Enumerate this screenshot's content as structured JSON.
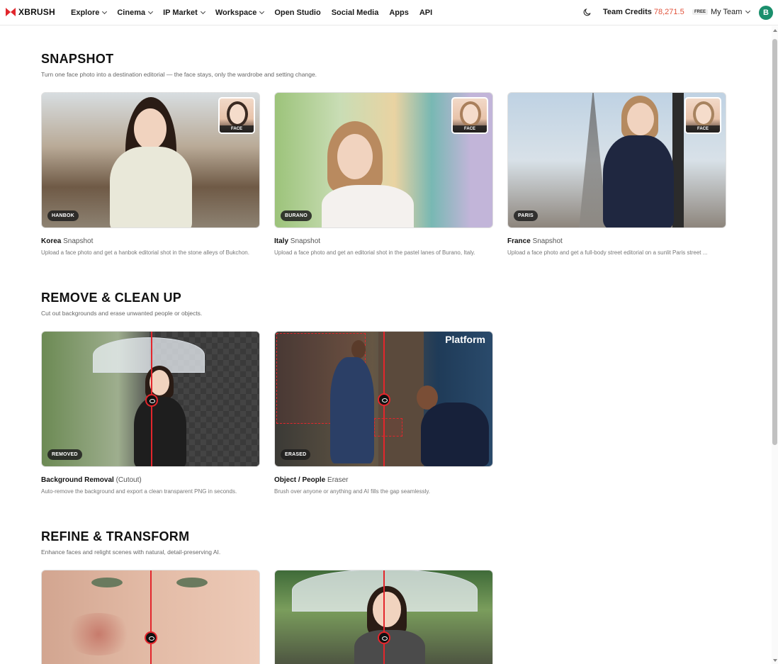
{
  "header": {
    "logo_text": "XBRUSH",
    "nav": [
      {
        "label": "Explore",
        "dropdown": true
      },
      {
        "label": "Cinema",
        "dropdown": true
      },
      {
        "label": "IP Market",
        "dropdown": true
      },
      {
        "label": "Workspace",
        "dropdown": true
      },
      {
        "label": "Open Studio",
        "dropdown": false
      },
      {
        "label": "Social Media",
        "dropdown": false
      },
      {
        "label": "Apps",
        "dropdown": false
      },
      {
        "label": "API",
        "dropdown": false
      }
    ],
    "credits_label": "Team Credits",
    "credits_value": "78,271.5",
    "plan_badge": "FREE",
    "team_label": "My Team",
    "avatar_initial": "B"
  },
  "sections": [
    {
      "title": "SNAPSHOT",
      "subtitle": "Turn one face photo into a destination editorial — the face stays, only the wardrobe and setting change.",
      "cards": [
        {
          "tag": "HANBOK",
          "face_label": "FACE",
          "title_bold": "Korea",
          "title_light": "Snapshot",
          "desc": "Upload a face photo and get a hanbok editorial shot in the stone alleys of Bukchon."
        },
        {
          "tag": "BURANO",
          "face_label": "FACE",
          "title_bold": "Italy",
          "title_light": "Snapshot",
          "desc": "Upload a face photo and get an editorial shot in the pastel lanes of Burano, Italy."
        },
        {
          "tag": "PARIS",
          "face_label": "FACE",
          "title_bold": "France",
          "title_light": "Snapshot",
          "desc": "Upload a face photo and get a full-body street editorial on a sunlit Paris street ..."
        }
      ]
    },
    {
      "title": "REMOVE & CLEAN UP",
      "subtitle": "Cut out backgrounds and erase unwanted people or objects.",
      "cards": [
        {
          "tag": "REMOVED",
          "title_bold": "Background Removal",
          "title_light": "(Cutout)",
          "desc": "Auto-remove the background and export a clean transparent PNG in seconds."
        },
        {
          "tag": "ERASED",
          "title_bold": "Object / People",
          "title_light": "Eraser",
          "desc": "Brush over anyone or anything and AI fills the gap seamlessly.",
          "scene_text": "Platform"
        }
      ]
    },
    {
      "title": "REFINE & TRANSFORM",
      "subtitle": "Enhance faces and relight scenes with natural, detail-preserving AI.",
      "cards": []
    }
  ],
  "icons": {
    "theme_toggle": "moon-icon",
    "logo": "xbrush-logo-icon",
    "compare_handle": "eye-icon"
  },
  "colors": {
    "brand_red": "#e1262c",
    "credits_value": "#e1533c",
    "avatar_bg": "#1a8f6c"
  }
}
